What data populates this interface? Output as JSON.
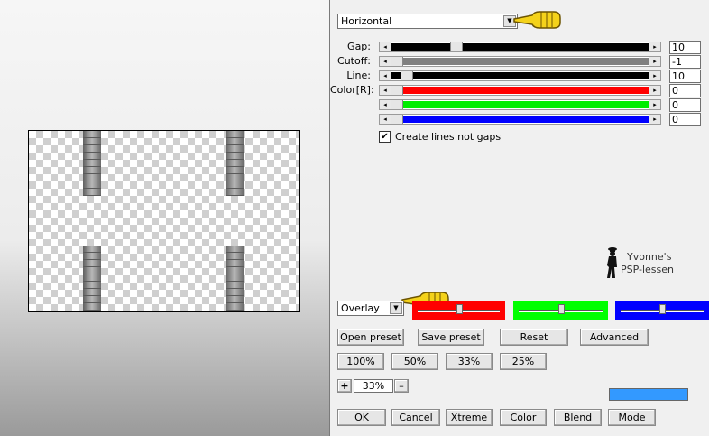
{
  "effect_combo": {
    "value": "Horizontal"
  },
  "sliders": [
    {
      "label": "Gap:",
      "value": "10",
      "fill": "#000000",
      "level": 0.24
    },
    {
      "label": "Cutoff:",
      "value": "-1",
      "fill": "#808080",
      "level": 0.0
    },
    {
      "label": "Line:",
      "value": "10",
      "fill": "#000000",
      "level": 0.04
    },
    {
      "label": "Color[R]:",
      "value": "0",
      "fill": "#ff0000",
      "level": 0.0
    },
    {
      "label": "",
      "value": "0",
      "fill": "#00ee00",
      "level": 0.0
    },
    {
      "label": "",
      "value": "0",
      "fill": "#0000ff",
      "level": 0.0
    }
  ],
  "checkbox": {
    "label": "Create lines not gaps",
    "checked": true,
    "mark": "✔"
  },
  "blend_combo": {
    "value": "Overlay"
  },
  "color_channels": [
    {
      "color": "#ff0000",
      "level": 0.5
    },
    {
      "color": "#00ff00",
      "level": 0.5
    },
    {
      "color": "#0000ff",
      "level": 0.5
    }
  ],
  "buttons": {
    "open_preset": "Open preset",
    "save_preset": "Save preset",
    "reset": "Reset",
    "advanced": "Advanced",
    "zoom_100": "100%",
    "zoom_50": "50%",
    "zoom_33": "33%",
    "zoom_25": "25%",
    "ok": "OK",
    "cancel": "Cancel",
    "xtreme": "Xtreme",
    "color": "Color",
    "blend": "Blend",
    "mode": "Mode"
  },
  "zoom": {
    "plus": "+",
    "minus": "–",
    "value": "33%"
  },
  "watermark": {
    "line1": "Yvonne's",
    "line2": "PSP-lessen"
  },
  "accent_color": "#3399ff",
  "icons": [
    "pointing-hand-icon",
    "dropdown-arrow-icon",
    "checkmark-icon",
    "silhouette-logo-icon"
  ]
}
